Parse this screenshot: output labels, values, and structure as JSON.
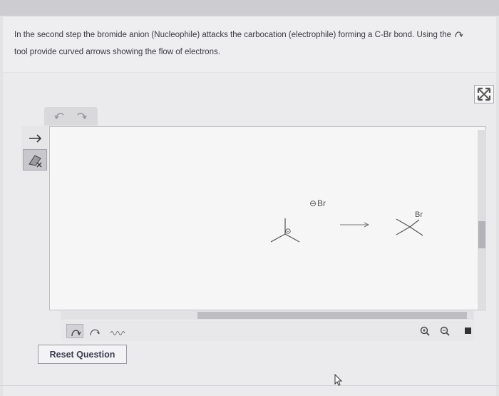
{
  "question": {
    "text_part1": "In the second step the bromide anion (Nucleophile) attacks the carbocation (electrophile) forming a C-Br bond.  Using the",
    "text_part2": "tool provide curved arrows showing the flow of electrons.",
    "inline_tool_icon": "curved-arrow-icon"
  },
  "toolbar": {
    "undo_icon": "undo-icon",
    "redo_icon": "redo-icon",
    "left_tools": [
      {
        "icon": "arrow-pointer-icon",
        "active": false
      },
      {
        "icon": "eraser-icon",
        "active": true
      }
    ],
    "arrow_tools": [
      "curved-arrow-icon",
      "single-barb-arrow-icon",
      "wavy-arrow-icon"
    ],
    "zoom_in_icon": "zoom-in-icon",
    "zoom_out_icon": "zoom-out-icon",
    "expand_icon": "expand-icon",
    "reset_label": "Reset Question"
  },
  "canvas": {
    "reactant_carbocation_charge": "+",
    "nucleophile_charge": "⊖",
    "nucleophile_label": "Br",
    "product_label": "Br"
  },
  "colors": {
    "background": "#e3e3e6",
    "canvas": "#f6f6f7",
    "text": "#3a3a40",
    "structure": "#555555"
  }
}
